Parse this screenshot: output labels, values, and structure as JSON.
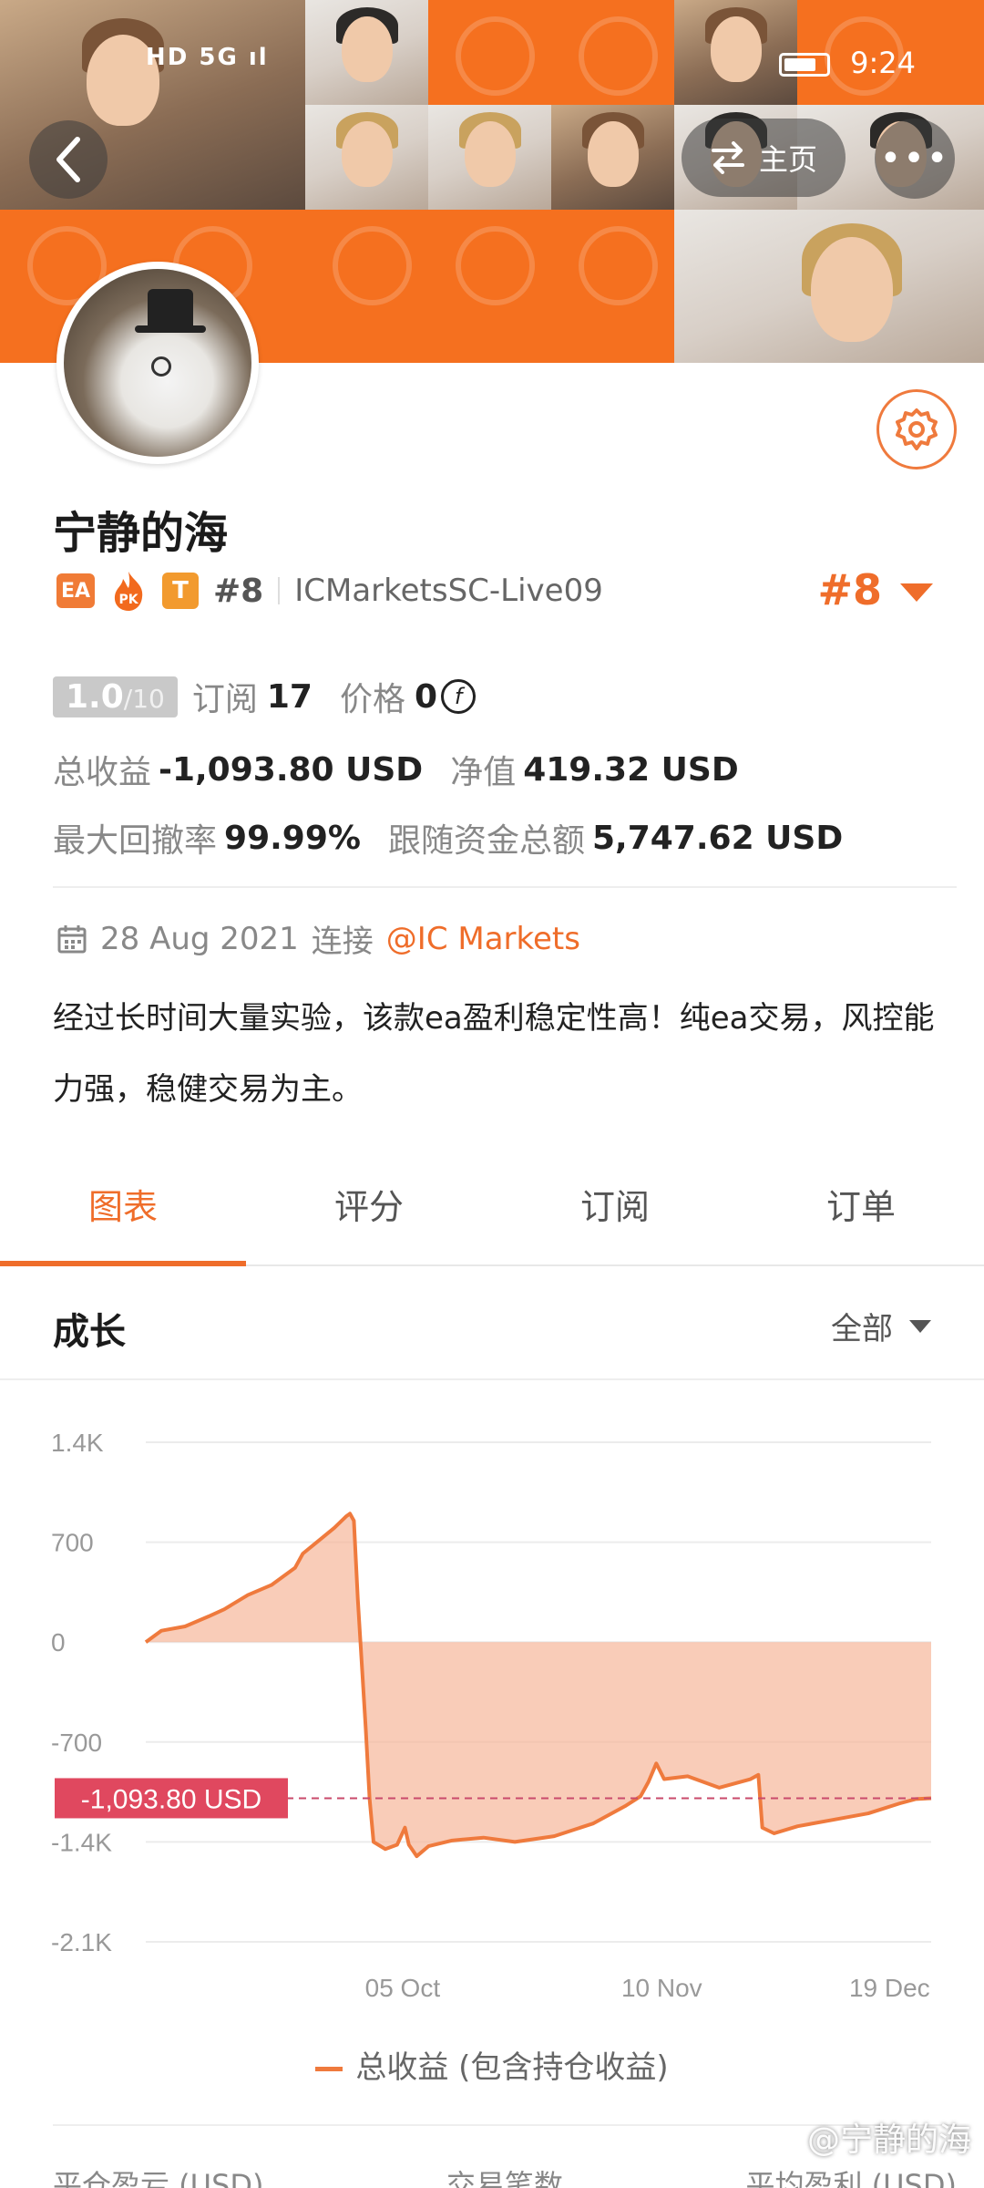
{
  "status_bar": {
    "time": "9:24",
    "left_icons": "HD 5G ıl"
  },
  "header": {
    "home_label": "主页",
    "more_label": "•••"
  },
  "profile": {
    "name": "宁静的海",
    "rank_small": "#8",
    "broker": "ICMarketsSC-Live09",
    "rank_big": "#8",
    "badges": {
      "ea": "EA",
      "pk": "PK",
      "t": "T"
    }
  },
  "stats": {
    "score": "1.0",
    "score_max": "/10",
    "subscribe_label": "订阅",
    "subscribe_count": "17",
    "price_label": "价格",
    "price_value": "0",
    "total_profit_label": "总收益",
    "total_profit_value": "-1,093.80 USD",
    "equity_label": "净值",
    "equity_value": "419.32 USD",
    "drawdown_label": "最大回撤率",
    "drawdown_value": "99.99%",
    "follow_label": "跟随资金总额",
    "follow_value": "5,747.62 USD"
  },
  "info": {
    "date": "28 Aug 2021",
    "connect_label": "连接",
    "broker_link": "@IC Markets",
    "description": "经过长时间大量实验，该款ea盈利稳定性高！纯ea交易，风控能力强，稳健交易为主。"
  },
  "tabs": [
    {
      "label": "图表",
      "active": true
    },
    {
      "label": "评分",
      "active": false
    },
    {
      "label": "订阅",
      "active": false
    },
    {
      "label": "订单",
      "active": false
    }
  ],
  "section": {
    "title": "成长",
    "filter": "全部"
  },
  "chart_data": {
    "type": "area",
    "y_ticks": [
      "1.4K",
      "700",
      "0",
      "-700",
      "-1.4K",
      "-2.1K"
    ],
    "y_tick_values": [
      1400,
      700,
      0,
      -700,
      -1400,
      -2100
    ],
    "ylim": [
      -2100,
      1400
    ],
    "x_ticks": [
      "05 Oct",
      "10 Nov",
      "19 Dec"
    ],
    "x_tick_positions": [
      0.327,
      0.657,
      0.947
    ],
    "current_label": "-1,093.80 USD",
    "current_value": -1093.8,
    "series": [
      {
        "name": "总收益 (包含持仓收益)",
        "color": "#ef7a3d",
        "points": [
          [
            0.0,
            0
          ],
          [
            0.02,
            80
          ],
          [
            0.05,
            110
          ],
          [
            0.08,
            180
          ],
          [
            0.1,
            230
          ],
          [
            0.13,
            330
          ],
          [
            0.16,
            400
          ],
          [
            0.19,
            520
          ],
          [
            0.2,
            620
          ],
          [
            0.22,
            710
          ],
          [
            0.24,
            800
          ],
          [
            0.255,
            880
          ],
          [
            0.26,
            900
          ],
          [
            0.265,
            850
          ],
          [
            0.27,
            300
          ],
          [
            0.28,
            -600
          ],
          [
            0.285,
            -1100
          ],
          [
            0.29,
            -1400
          ],
          [
            0.305,
            -1450
          ],
          [
            0.32,
            -1420
          ],
          [
            0.33,
            -1300
          ],
          [
            0.335,
            -1420
          ],
          [
            0.345,
            -1500
          ],
          [
            0.36,
            -1430
          ],
          [
            0.39,
            -1390
          ],
          [
            0.43,
            -1370
          ],
          [
            0.47,
            -1400
          ],
          [
            0.52,
            -1360
          ],
          [
            0.57,
            -1270
          ],
          [
            0.61,
            -1150
          ],
          [
            0.63,
            -1080
          ],
          [
            0.64,
            -980
          ],
          [
            0.65,
            -850
          ],
          [
            0.66,
            -960
          ],
          [
            0.69,
            -940
          ],
          [
            0.73,
            -1020
          ],
          [
            0.77,
            -960
          ],
          [
            0.78,
            -930
          ],
          [
            0.785,
            -1300
          ],
          [
            0.8,
            -1340
          ],
          [
            0.83,
            -1290
          ],
          [
            0.87,
            -1250
          ],
          [
            0.92,
            -1200
          ],
          [
            0.96,
            -1130
          ],
          [
            0.98,
            -1100
          ],
          [
            1.0,
            -1093.8
          ]
        ]
      }
    ],
    "legend": "总收益 (包含持仓收益)"
  },
  "bottom_stats": [
    "平仓盈亏 (USD)",
    "交易笔数",
    "平均盈利 (USD)"
  ],
  "watermark": "@宁静的海"
}
